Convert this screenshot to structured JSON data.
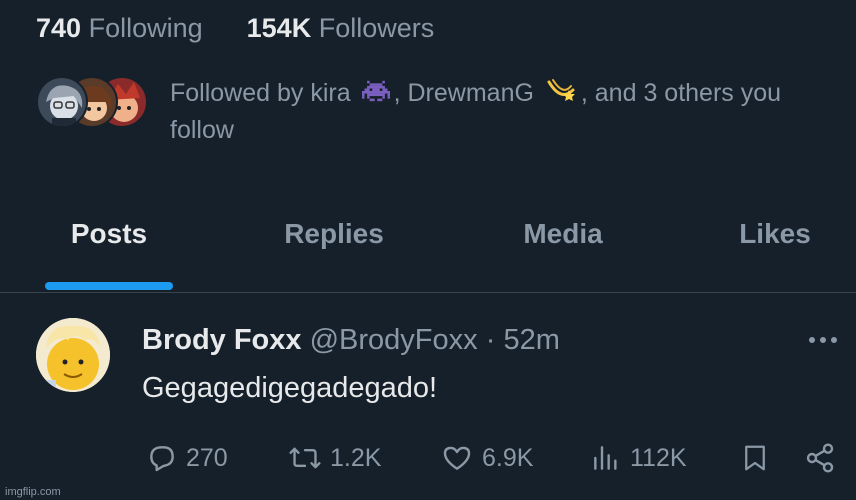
{
  "profile_stats": {
    "following_count": "740",
    "following_label": "Following",
    "followers_count": "154K",
    "followers_label": "Followers"
  },
  "followed_by": {
    "prefix": "Followed by kira",
    "name_2": "DrewmanG",
    "suffix": "and 3 others you follow",
    "sep_1": ",",
    "sep_2": ","
  },
  "tabs": [
    {
      "label": "Posts",
      "active": true
    },
    {
      "label": "Replies",
      "active": false
    },
    {
      "label": "Media",
      "active": false
    },
    {
      "label": "Likes",
      "active": false
    }
  ],
  "post": {
    "author_name": "Brody Foxx",
    "author_handle": "@BrodyFoxx",
    "dot": "·",
    "time": "52m",
    "text": "Gegagedigegadegado!",
    "replies": "270",
    "reposts": "1.2K",
    "likes": "6.9K",
    "views": "112K"
  },
  "watermark": "imgflip.com",
  "colors": {
    "background": "#15202b",
    "accent": "#1d9bf0",
    "muted": "#8b98a5"
  },
  "icons": [
    "alien-monster-emoji-icon",
    "shooting-star-emoji-icon",
    "reply-icon",
    "repost-icon",
    "like-icon",
    "views-icon",
    "bookmark-icon",
    "share-icon",
    "more-icon"
  ]
}
